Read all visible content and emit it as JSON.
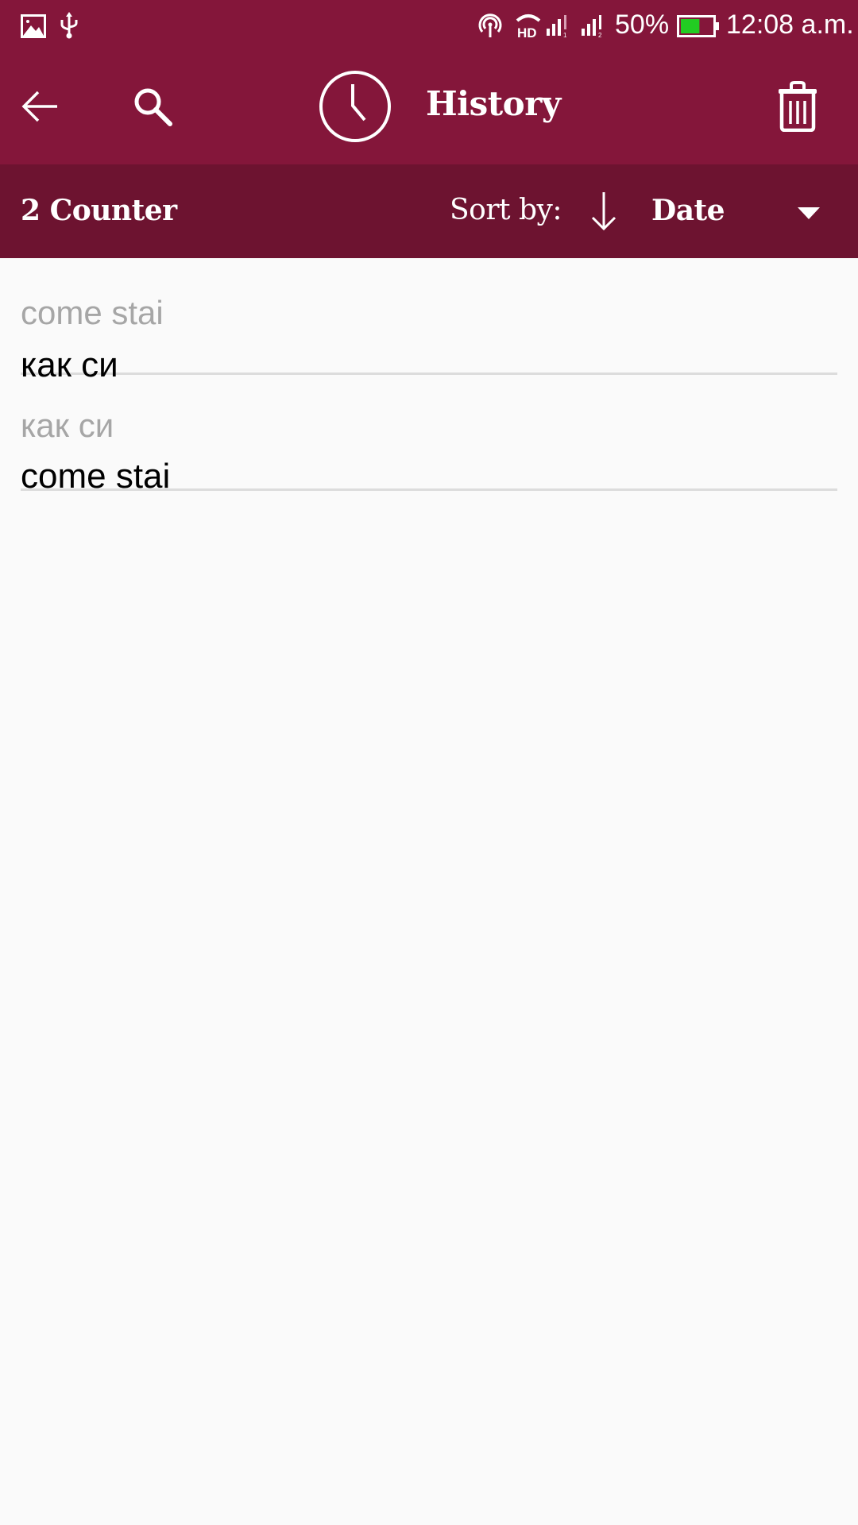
{
  "status_bar": {
    "left_icons": [
      "image-icon",
      "usb-icon"
    ],
    "right_icons": [
      "hotspot-icon",
      "hd-voice-icon",
      "signal-sim1-icon",
      "signal-sim2-icon"
    ],
    "battery_percent": "50%",
    "battery_level": 0.5,
    "time": "12:08 a.m."
  },
  "toolbar": {
    "title": "History",
    "back_icon": "arrow-left-icon",
    "search_icon": "search-icon",
    "title_icon": "clock-icon",
    "delete_icon": "trash-icon"
  },
  "subheader": {
    "counter": "2 Counter",
    "sort_label": "Sort by:",
    "sort_direction_icon": "arrow-down-icon",
    "sort_value": "Date",
    "dropdown_icon": "triangle-down-icon"
  },
  "history": [
    {
      "source": "come stai",
      "translation": "как си"
    },
    {
      "source": "как си",
      "translation": "come stai"
    }
  ],
  "colors": {
    "toolbar": "#84163a",
    "subheader": "#6d1330",
    "background": "#fafafa",
    "battery_fill": "#22cc22"
  }
}
